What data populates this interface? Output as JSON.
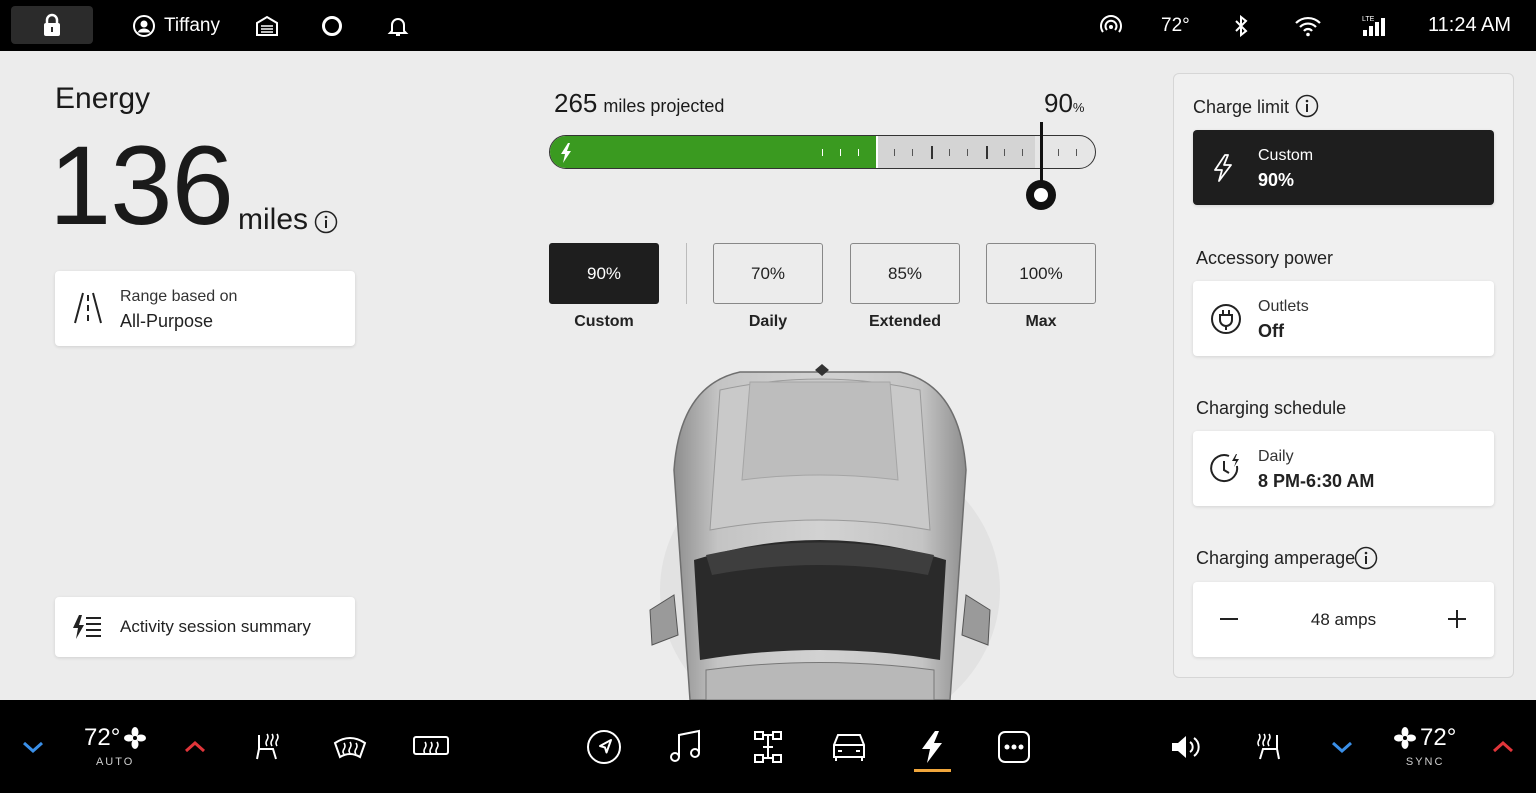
{
  "topbar": {
    "user": "Tiffany",
    "temperature": "72°",
    "time": "11:24 AM",
    "lte": "LTE"
  },
  "energy": {
    "title": "Energy",
    "range_value": "136",
    "range_unit": "miles",
    "range_card": {
      "line1": "Range based on",
      "line2": "All-Purpose"
    },
    "activity_label": "Activity session summary"
  },
  "charge": {
    "projected_value": "265",
    "projected_label": "miles projected",
    "limit_value": "90",
    "limit_unit": "%",
    "state_of_charge": 0.6,
    "limit_fraction": 0.9,
    "presets": [
      {
        "value": "90%",
        "label": "Custom",
        "selected": true
      },
      {
        "value": "70%",
        "label": "Daily",
        "selected": false
      },
      {
        "value": "85%",
        "label": "Extended",
        "selected": false
      },
      {
        "value": "100%",
        "label": "Max",
        "selected": false
      }
    ]
  },
  "panel": {
    "charge_limit": {
      "title": "Charge limit",
      "line1": "Custom",
      "line2": "90%"
    },
    "accessory_power": {
      "title": "Accessory power",
      "line1": "Outlets",
      "line2": "Off"
    },
    "charging_schedule": {
      "title": "Charging schedule",
      "line1": "Daily",
      "line2": "8 PM-6:30 AM"
    },
    "charging_amperage": {
      "title": "Charging amperage",
      "value": "48 amps"
    }
  },
  "climate": {
    "left_temp": "72°",
    "left_mode": "AUTO",
    "right_temp": "72°",
    "right_mode": "SYNC"
  },
  "colors": {
    "charge_green": "#3a9a20",
    "active_orange": "#f0a63c",
    "temp_down_blue": "#3a8fe8",
    "temp_up_red": "#e0353a"
  },
  "icons": [
    "lock-icon",
    "profile-icon",
    "garage-icon",
    "alexa-icon",
    "bell-icon",
    "connectivity-icon",
    "bluetooth-icon",
    "wifi-icon",
    "signal-icon",
    "road-icon",
    "activity-icon",
    "info-icon",
    "bolt-icon",
    "outlet-icon",
    "schedule-icon",
    "minus-icon",
    "plus-icon",
    "fan-icon",
    "seat-heat-icon",
    "defrost-front-icon",
    "defrost-rear-icon",
    "navigation-icon",
    "music-icon",
    "drive-modes-icon",
    "vehicle-icon",
    "energy-icon",
    "more-icon",
    "volume-icon",
    "chevron-down-icon",
    "chevron-up-icon"
  ]
}
